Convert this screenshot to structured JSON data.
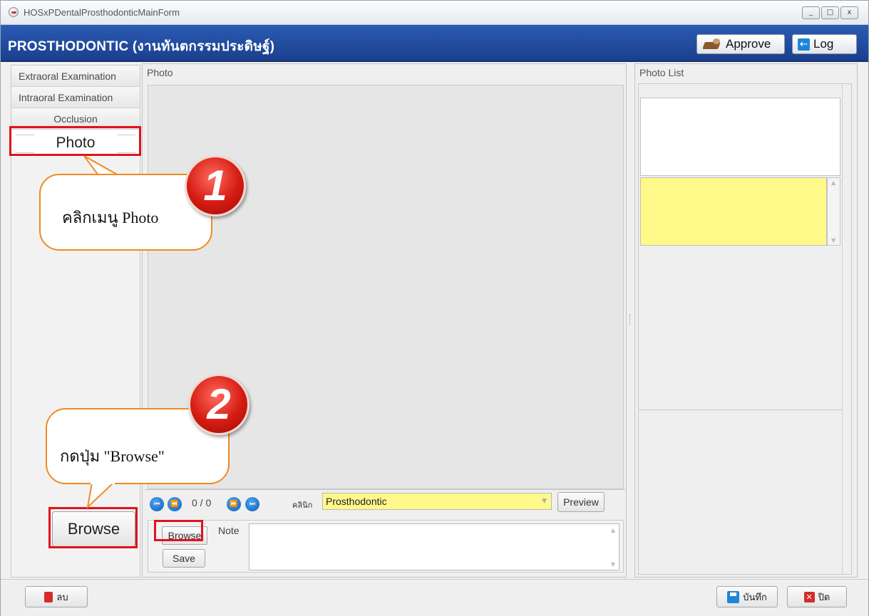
{
  "window": {
    "title": "HOSxPDentalProsthodonticMainForm",
    "controls": [
      "_",
      "□",
      "x"
    ]
  },
  "header": {
    "title": "PROSTHODONTIC (งานทันตกรรมประดิษฐ์)",
    "approve_label": "Approve",
    "log_label": "Log"
  },
  "sidebar": {
    "items": [
      {
        "label": "Extraoral Examination"
      },
      {
        "label": "Intraoral Examination"
      },
      {
        "label": "Occlusion"
      },
      {
        "label": "Photo"
      }
    ],
    "browse_label": "Browse"
  },
  "photo_panel": {
    "title": "Photo",
    "nav": {
      "first_icon": "first-icon",
      "prev_icon": "prev-icon",
      "count": "0 / 0",
      "next_icon": "next-icon",
      "last_icon": "last-icon"
    },
    "clinic_label": "คลินิก",
    "clinic_value": "Prosthodontic",
    "preview_label": "Preview",
    "browse_label": "Browse",
    "save_label": "Save",
    "note_label": "Note",
    "note_value": ""
  },
  "photo_list": {
    "title": "Photo List"
  },
  "footer": {
    "delete_label": "ลบ",
    "save_label": "บันทึก",
    "close_label": "ปิด"
  },
  "annotations": {
    "step1_number": "1",
    "step1_text": "คลิกเมนู Photo",
    "step2_number": "2",
    "step2_text": "กดปุ่ม \"Browse\"",
    "highlight_color": "#e0121b",
    "callout_border_color": "#f08a24"
  },
  "colors": {
    "header_blue": "#1f4a9e",
    "input_yellow": "#fff98a"
  }
}
